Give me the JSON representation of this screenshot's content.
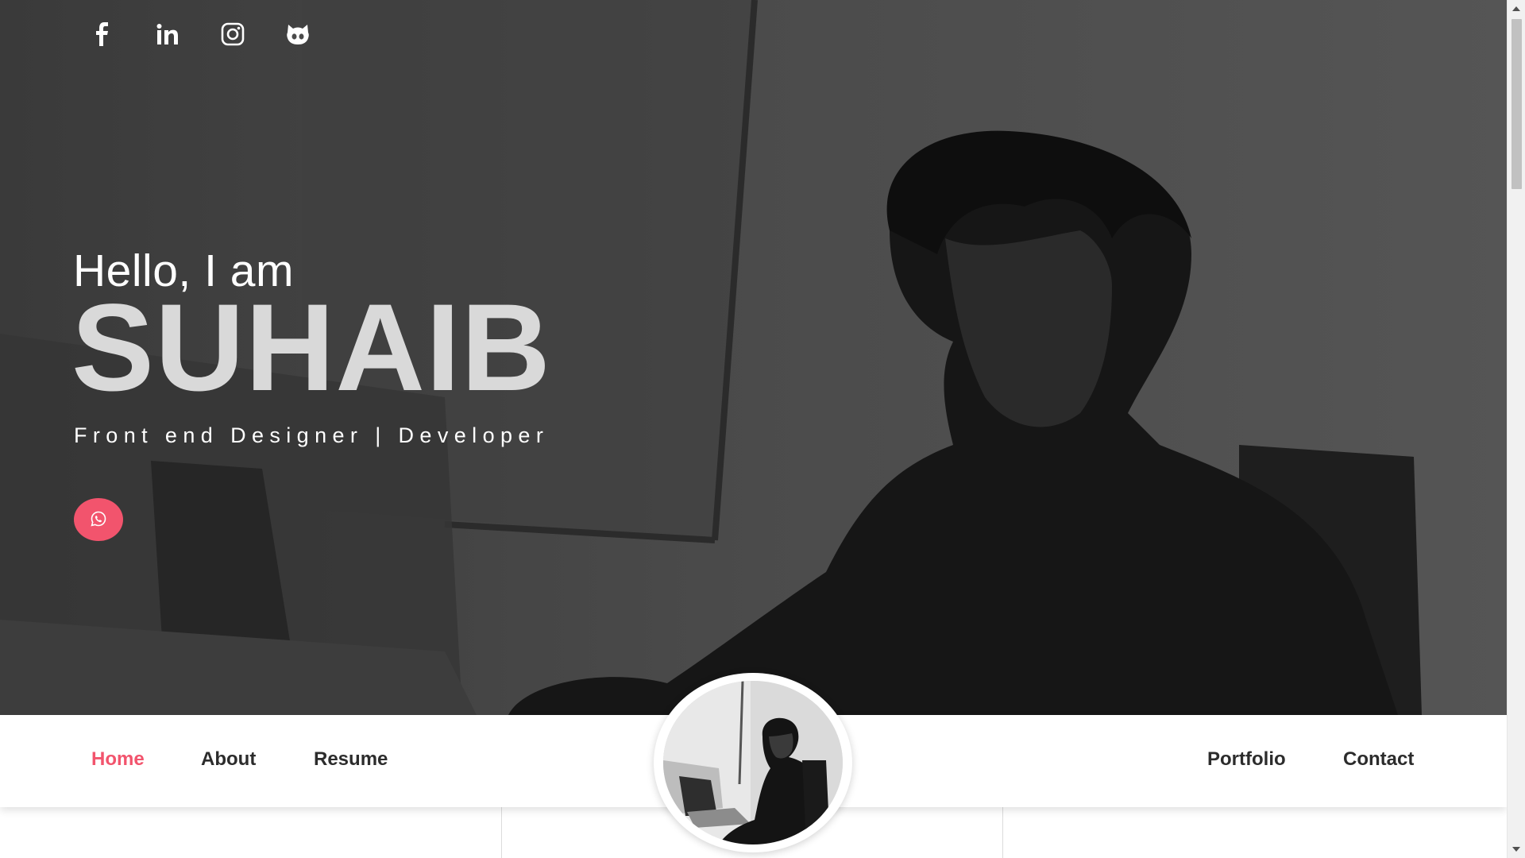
{
  "hero": {
    "greeting": "Hello, I am",
    "name": "SUHAIB",
    "tagline": "Front end Designer | Developer"
  },
  "social": [
    {
      "icon": "facebook-icon"
    },
    {
      "icon": "linkedin-icon"
    },
    {
      "icon": "instagram-icon"
    },
    {
      "icon": "github-icon"
    }
  ],
  "whatsapp": {
    "icon": "whatsapp-icon"
  },
  "nav": {
    "left": [
      {
        "label": "Home",
        "active": true
      },
      {
        "label": "About",
        "active": false
      },
      {
        "label": "Resume",
        "active": false
      }
    ],
    "right": [
      {
        "label": "Portfolio",
        "active": false
      },
      {
        "label": "Contact",
        "active": false
      }
    ]
  },
  "colors": {
    "accent": "#f2546d",
    "hero_overlay": "#4a4a4a",
    "nav_text": "#2c2c2c"
  }
}
